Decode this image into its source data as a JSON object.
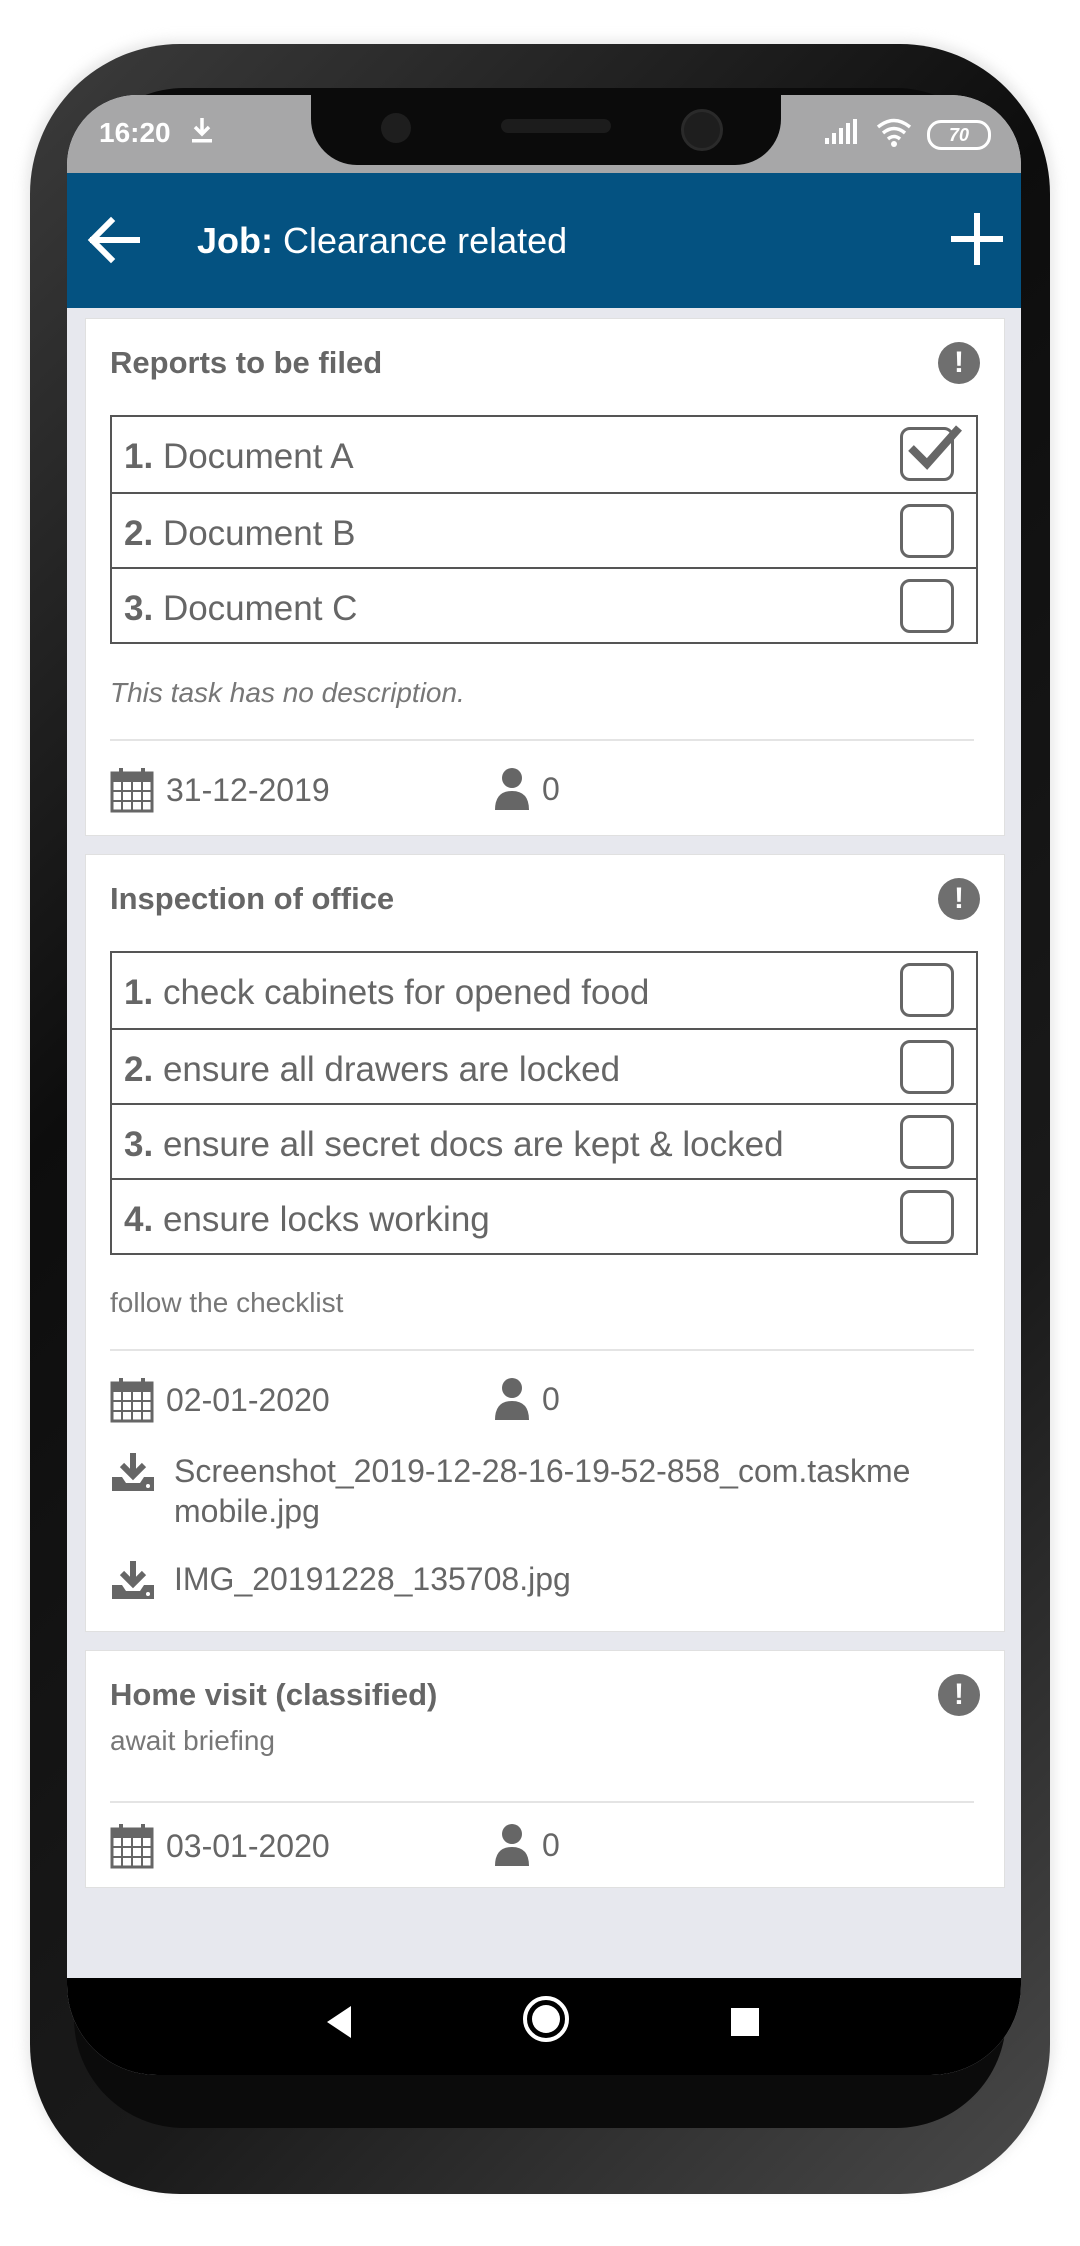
{
  "status": {
    "time": "16:20",
    "battery": "70"
  },
  "appbar": {
    "title_prefix": "Job:",
    "title": "Clearance related"
  },
  "cards": [
    {
      "title": "Reports to be filed",
      "items": [
        {
          "num": "1.",
          "text": "Document A",
          "checked": true
        },
        {
          "num": "2.",
          "text": "Document B",
          "checked": false
        },
        {
          "num": "3.",
          "text": "Document C",
          "checked": false
        }
      ],
      "description": "This task has no description.",
      "date": "31-12-2019",
      "assignees": "0"
    },
    {
      "title": "Inspection of office",
      "items": [
        {
          "num": "1.",
          "text": "check cabinets for opened food",
          "checked": false
        },
        {
          "num": "2.",
          "text": "ensure all drawers are locked",
          "checked": false
        },
        {
          "num": "3.",
          "text": "ensure all secret docs are kept & locked",
          "checked": false
        },
        {
          "num": "4.",
          "text": "ensure locks working",
          "checked": false
        }
      ],
      "description": "follow the checklist",
      "date": "02-01-2020",
      "assignees": "0",
      "attachments": [
        {
          "line1": "Screenshot_2019-12-28-16-19-52-858_com.taskme",
          "line2": "mobile.jpg"
        },
        {
          "line1": "IMG_20191228_135708.jpg",
          "line2": ""
        }
      ]
    },
    {
      "title": "Home visit (classified)",
      "description": "await briefing",
      "date": "03-01-2020",
      "assignees": "0"
    }
  ],
  "icons": {
    "back": "arrow-left-icon",
    "add": "plus-icon",
    "alert": "exclamation-circle-icon",
    "calendar": "calendar-icon",
    "user": "user-icon",
    "download": "download-icon"
  },
  "colors": {
    "appbar": "#045281",
    "text": "#666666",
    "background": "#e7e8ee"
  }
}
